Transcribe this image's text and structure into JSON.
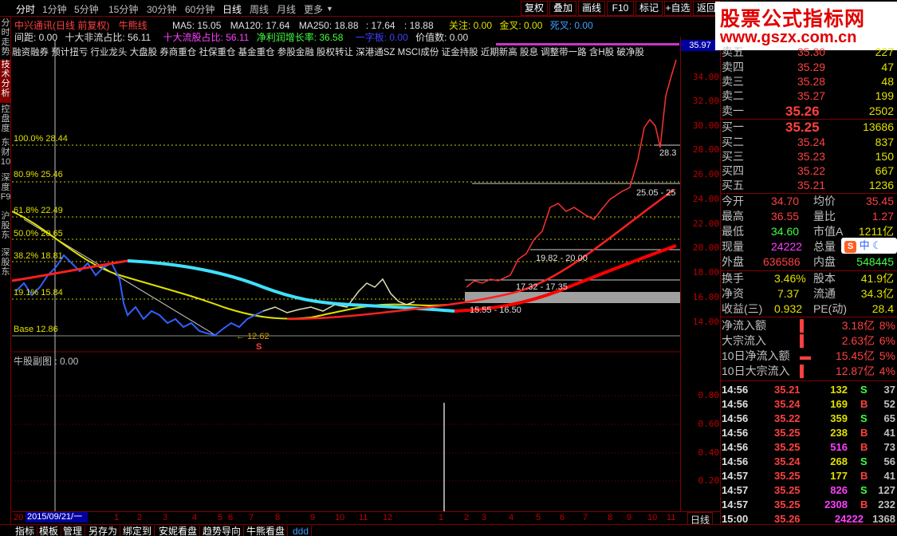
{
  "toolbar": {
    "periods": [
      "分时",
      "1分钟",
      "5分钟",
      "15分钟",
      "30分钟",
      "60分钟",
      "日线",
      "周线",
      "月线",
      "更多"
    ],
    "right_buttons": [
      "复权",
      "叠加",
      "画线",
      "F10",
      "标记",
      "+自选",
      "返回"
    ]
  },
  "left_tabs": [
    "分时走势",
    "技术分析",
    "控盘度",
    "东财10",
    "深度F9",
    "沪股东",
    "深股东"
  ],
  "info": {
    "stock_title": "中兴通讯(日线 前复权)",
    "indicator_name": "牛熊线",
    "ma5": "MA5: 15.05",
    "ma120": "MA120: 17.64",
    "ma250": "MA250: 18.88",
    "val1": ": 17.64",
    "val2": ": 18.88",
    "attention": "关注: 0.00",
    "golden_cross": "金叉: 0.00",
    "dead_cross": "死叉: 0.00",
    "spacing": "间距: 0.00",
    "top10_float_ratio": "十大非流占比: 56.11",
    "top10_holder_ratio": "十大流股占比: 56.11",
    "net_profit_growth": "净利润增长率: 36.58",
    "one_shot": "一字板: 0.00",
    "value_number": "价值数: 0.00",
    "concept_line": "融资融券 预计扭亏 行业龙头 大盘股 券商重仓 社保重仓 基金重仓 参股金融 股权转让 深港通SZ MSCI成份 证金持股 近期新高 股息 调整带一路 含H股 破净股"
  },
  "fib_labels": [
    "100.0% 28.44",
    "80.9% 25.46",
    "61.8% 22.49",
    "50.0% 20.65",
    "38.2% 18.81",
    "19.1% 15.84",
    "Base 12.86"
  ],
  "annotations": {
    "low_marker": "12.62",
    "s_marker": "S",
    "right_top": "28.3",
    "zone1": "25.05 - 25",
    "zone2": "19.82 - 20.00",
    "zone3": "17.32 - 17.35",
    "zone4": "15.55 - 16.50"
  },
  "price_box": "35.97",
  "y_ticks": [
    "34.00",
    "32.00",
    "30.00",
    "28.00",
    "26.00",
    "24.00",
    "22.00",
    "20.00",
    "18.00",
    "16.00",
    "14.00"
  ],
  "sub_chart": {
    "label": "牛股副图 : 0.00",
    "ticks": [
      "0.80",
      "0.60",
      "0.40",
      "0.20"
    ]
  },
  "x_axis": {
    "date_box": "2015/09/21/一",
    "ticks": [
      "20",
      "1",
      "2",
      "3",
      "4",
      "5",
      "6",
      "7",
      "8",
      "9",
      "10",
      "11",
      "12",
      "1",
      "2",
      "3",
      "4",
      "5",
      "6",
      "7",
      "8",
      "9",
      "10",
      "11"
    ],
    "period_label": "日线"
  },
  "bottom_tabs": [
    "指标",
    "模板",
    "管理",
    "另存为",
    "绑定到",
    "安妮看盘",
    "趋势导向",
    "牛熊看盘",
    "ddd"
  ],
  "logo": {
    "line1": "股票公式指标网",
    "line2": "www.gszx.com.cn"
  },
  "asks": [
    {
      "label": "卖五",
      "price": "35.30",
      "vol": "227"
    },
    {
      "label": "卖四",
      "price": "35.29",
      "vol": "47"
    },
    {
      "label": "卖三",
      "price": "35.28",
      "vol": "48"
    },
    {
      "label": "卖二",
      "price": "35.27",
      "vol": "199"
    },
    {
      "label": "卖一",
      "price": "35.26",
      "vol": "2502"
    }
  ],
  "bids": [
    {
      "label": "买一",
      "price": "35.25",
      "vol": "13686"
    },
    {
      "label": "买二",
      "price": "35.24",
      "vol": "837"
    },
    {
      "label": "买三",
      "price": "35.23",
      "vol": "150"
    },
    {
      "label": "买四",
      "price": "35.22",
      "vol": "667"
    },
    {
      "label": "买五",
      "price": "35.21",
      "vol": "1236"
    }
  ],
  "stats": [
    {
      "l1": "今开",
      "v1": "34.70",
      "l2": "均价",
      "v2": "35.45"
    },
    {
      "l1": "最高",
      "v1": "36.55",
      "l2": "量比",
      "v2": "1.27"
    },
    {
      "l1": "最低",
      "v1": "34.60",
      "l2": "市值A",
      "v2": "1211亿"
    },
    {
      "l1": "现量",
      "v1": "24222",
      "l2": "总量",
      "v2": ""
    },
    {
      "l1": "外盘",
      "v1": "636586",
      "l2": "内盘",
      "v2": "548445"
    }
  ],
  "stats2": [
    {
      "l1": "换手",
      "v1": "3.46%",
      "l2": "股本",
      "v2": "41.9亿"
    },
    {
      "l1": "净资",
      "v1": "7.37",
      "l2": "流通",
      "v2": "34.3亿"
    },
    {
      "l1": "收益(三)",
      "v1": "0.932",
      "l2": "PE(动)",
      "v2": "28.4"
    }
  ],
  "flows": [
    {
      "label": "净流入额",
      "value": "3.18亿",
      "pct": "8%"
    },
    {
      "label": "大宗流入",
      "value": "2.63亿",
      "pct": "6%"
    },
    {
      "label": "10日净流入额",
      "value": "15.45亿",
      "pct": "5%"
    },
    {
      "label": "10日大宗流入",
      "value": "12.87亿",
      "pct": "4%"
    }
  ],
  "ime": "中",
  "trades": [
    {
      "time": "14:56",
      "price": "35.21",
      "vol": "132",
      "side": "S",
      "n": "37"
    },
    {
      "time": "14:56",
      "price": "35.24",
      "vol": "169",
      "side": "B",
      "n": "52"
    },
    {
      "time": "14:56",
      "price": "35.22",
      "vol": "359",
      "side": "S",
      "n": "65"
    },
    {
      "time": "14:56",
      "price": "35.25",
      "vol": "238",
      "side": "B",
      "n": "41"
    },
    {
      "time": "14:56",
      "price": "35.25",
      "vol": "516",
      "side": "B",
      "n": "73"
    },
    {
      "time": "14:56",
      "price": "35.24",
      "vol": "268",
      "side": "S",
      "n": "56"
    },
    {
      "time": "14:57",
      "price": "35.25",
      "vol": "177",
      "side": "B",
      "n": "41"
    },
    {
      "time": "14:57",
      "price": "35.25",
      "vol": "826",
      "side": "S",
      "n": "127"
    },
    {
      "time": "14:57",
      "price": "35.25",
      "vol": "2308",
      "side": "B",
      "n": "232"
    },
    {
      "time": "15:00",
      "price": "35.26",
      "vol": "24222",
      "side": "",
      "n": "1368"
    }
  ]
}
